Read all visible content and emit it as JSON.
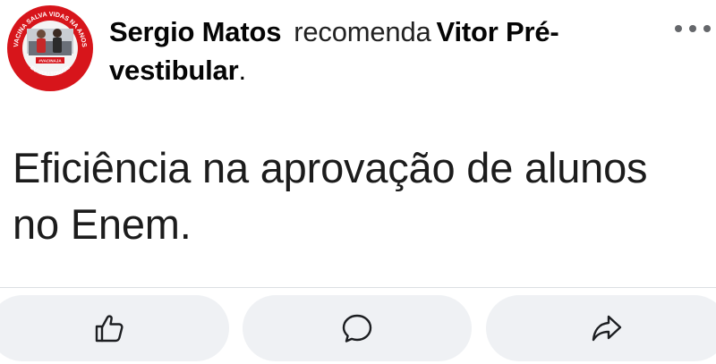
{
  "post": {
    "author_name": "Sergio Matos",
    "action_verb": "recomenda",
    "page_name": "Vitor Pré-vestibular",
    "period": ".",
    "body_text": "Eficiência na aprovação de alunos no Enem."
  },
  "avatar": {
    "ring_top_text": "VACINA SALVA VIDAS NA ANOS",
    "ring_bottom_text": "EU VOU TOMAR!",
    "badge_text": "#VACINAJA",
    "ring_color": "#d7151b"
  },
  "icons": {
    "more": "more-horizontal-icon",
    "like": "thumbs-up-icon",
    "comment": "comment-bubble-icon",
    "share": "share-arrow-icon"
  },
  "colors": {
    "button_bg": "#eff1f4",
    "icon_stroke": "#1c1e21",
    "divider": "#dcdfe3"
  }
}
